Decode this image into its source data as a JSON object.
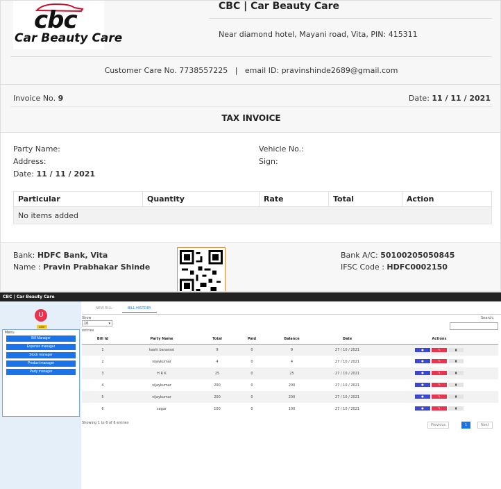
{
  "invoice": {
    "logo_text": "cbc",
    "logo_subtitle": "Car Beauty Care",
    "business_name": "CBC | Car Beauty Care",
    "address": "Near diamond hotel, Mayani road, Vita, PIN: 415311",
    "customer_care_line": "Customer Care No. 7738557225   |   email ID: pravinshinde2689@gmail.com",
    "invoice_no_label": "Invoice No. ",
    "invoice_no": "9",
    "date_label": "Date: ",
    "date": "11 / 11 / 2021",
    "title": "TAX INVOICE",
    "party_name_label": "Party Name:",
    "address_label": "Address:",
    "party_date_label": "Date: ",
    "party_date": "11 / 11 / 2021",
    "vehicle_no_label": "Vehicle No.:",
    "sign_label": "Sign:",
    "items_table": {
      "headers": [
        "Particular",
        "Quantity",
        "Rate",
        "Total",
        "Action"
      ],
      "empty_text": "No items added"
    },
    "bank_label": "Bank: ",
    "bank": "HDFC Bank, Vita",
    "name_label": "Name : ",
    "name": "Pravin Prabhakar Shinde",
    "account_label": "Bank A/C: ",
    "account": "50100205050845",
    "ifsc_label": "IFSC Code : ",
    "ifsc": "HDFC0002150"
  },
  "app": {
    "title": "CBC | Car Beauty Care",
    "user_initial": "U",
    "user_badge": "user",
    "menu_title": "Menu",
    "menu_items": [
      "Bill Manager",
      "Expense manager",
      "Stock manager",
      "Product manager",
      "Party manager"
    ],
    "tabs": [
      "NEW BILL",
      "BILL HISTORY"
    ],
    "active_tab": "BILL HISTORY",
    "show_label": "Show",
    "entries_value": "10",
    "entries_label": "entries",
    "search_label": "Search:",
    "table": {
      "headers": [
        "Bill Id",
        "Party Name",
        "Total",
        "Paid",
        "Balance",
        "Date",
        "Actions"
      ],
      "rows": [
        [
          "1",
          "kashi banarasi",
          "9",
          "0",
          "9",
          "27 / 10 / 2021"
        ],
        [
          "2",
          "vijaykumar",
          "4",
          "0",
          "4",
          "27 / 10 / 2021"
        ],
        [
          "3",
          "H R K",
          "25",
          "0",
          "25",
          "27 / 10 / 2021"
        ],
        [
          "4",
          "vijaykumar",
          "200",
          "0",
          "200",
          "27 / 10 / 2021"
        ],
        [
          "5",
          "vijaykumar",
          "200",
          "0",
          "200",
          "27 / 10 / 2021"
        ],
        [
          "6",
          "sagar",
          "100",
          "0",
          "100",
          "27 / 10 / 2021"
        ]
      ],
      "action_icons": [
        "eye-icon",
        "edit-icon",
        "trash-icon"
      ]
    },
    "showing_text": "Showing 1 to 6 of 6 entries",
    "pagination": {
      "previous": "Previous",
      "page": "1",
      "next": "Next"
    },
    "colors": {
      "primary": "#1a73e8",
      "view": "#3f47cc",
      "edit": "#e8344e",
      "avatar": "#e8344e",
      "badge": "#f5c518"
    }
  }
}
